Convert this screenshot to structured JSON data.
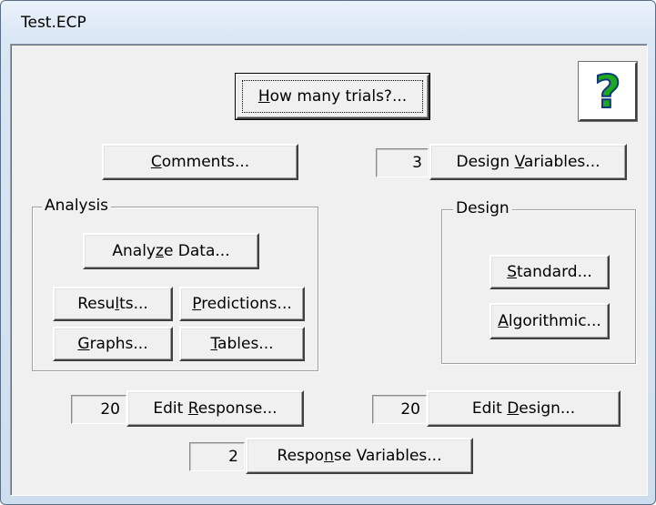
{
  "window": {
    "title": "Test.ECP"
  },
  "buttons": {
    "how_many_trials": {
      "pre": "",
      "ul": "H",
      "post": "ow many trials?..."
    },
    "comments": {
      "pre": "",
      "ul": "C",
      "post": "omments..."
    },
    "design_variables": {
      "pre": "Design ",
      "ul": "V",
      "post": "ariables..."
    },
    "analyze_data": {
      "pre": "Analy",
      "ul": "z",
      "post": "e Data..."
    },
    "results": {
      "pre": "Resu",
      "ul": "l",
      "post": "ts..."
    },
    "predictions": {
      "pre": "",
      "ul": "P",
      "post": "redictions..."
    },
    "graphs": {
      "pre": "",
      "ul": "G",
      "post": "raphs..."
    },
    "tables": {
      "pre": "",
      "ul": "T",
      "post": "ables..."
    },
    "standard": {
      "pre": "",
      "ul": "S",
      "post": "tandard..."
    },
    "algorithmic": {
      "pre": "",
      "ul": "A",
      "post": "lgorithmic..."
    },
    "edit_response": {
      "pre": "Edit ",
      "ul": "R",
      "post": "esponse..."
    },
    "edit_design": {
      "pre": "Edit ",
      "ul": "D",
      "post": "esign..."
    },
    "response_variables": {
      "pre": "Respo",
      "ul": "n",
      "post": "se Variables..."
    }
  },
  "counts": {
    "design_variables": "3",
    "edit_response": "20",
    "edit_design": "20",
    "response_variables": "2"
  },
  "groups": {
    "analysis": "Analysis",
    "design": "Design"
  },
  "help": {
    "icon": "question-mark-icon",
    "glyph": "?",
    "color": "#1ea51e"
  }
}
